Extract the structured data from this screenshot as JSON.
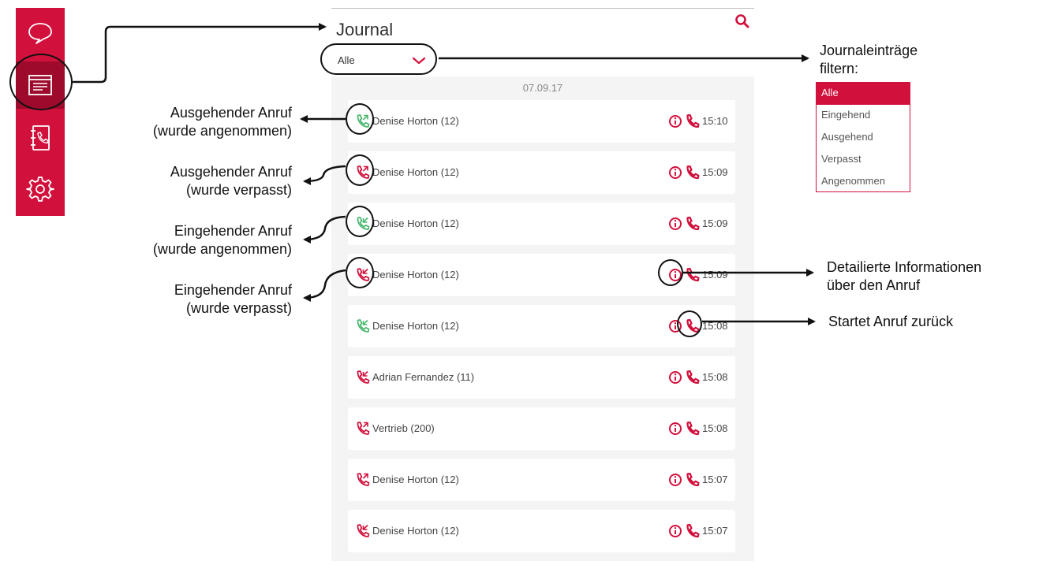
{
  "colors": {
    "accent": "#d2103c",
    "accent_dark": "#9e0a2c",
    "answered": "#49b86e",
    "missed": "#d2103c"
  },
  "sidebar": {
    "items": [
      {
        "name": "chat",
        "icon": "chat-bubble-icon",
        "active": false
      },
      {
        "name": "journal",
        "icon": "journal-icon",
        "active": true
      },
      {
        "name": "contacts",
        "icon": "phonebook-icon",
        "active": false
      },
      {
        "name": "settings",
        "icon": "gear-icon",
        "active": false
      }
    ]
  },
  "journal": {
    "title": "Journal",
    "search_icon": "search-icon",
    "filter": {
      "value": "Alle",
      "icon": "chevron-down-icon"
    },
    "date": "07.09.17",
    "entries": [
      {
        "direction": "outgoing",
        "status": "answered",
        "name": "Denise Horton (12)",
        "time": "15:10"
      },
      {
        "direction": "outgoing",
        "status": "missed",
        "name": "Denise Horton (12)",
        "time": "15:09"
      },
      {
        "direction": "incoming",
        "status": "answered",
        "name": "Denise Horton (12)",
        "time": "15:09"
      },
      {
        "direction": "incoming",
        "status": "missed",
        "name": "Denise Horton (12)",
        "time": "15:09"
      },
      {
        "direction": "incoming",
        "status": "answered",
        "name": "Denise Horton (12)",
        "time": "15:08"
      },
      {
        "direction": "incoming",
        "status": "missed",
        "name": "Adrian Fernandez (11)",
        "time": "15:08"
      },
      {
        "direction": "outgoing",
        "status": "missed",
        "name": "Vertrieb (200)",
        "time": "15:08"
      },
      {
        "direction": "outgoing",
        "status": "missed",
        "name": "Denise Horton (12)",
        "time": "15:07"
      },
      {
        "direction": "incoming",
        "status": "missed",
        "name": "Denise Horton (12)",
        "time": "15:07"
      }
    ]
  },
  "annotations": {
    "filter_heading": [
      "Journaleinträge",
      "filtern:"
    ],
    "filter_options": [
      "Alle",
      "Eingehend",
      "Ausgehend",
      "Verpasst",
      "Angenommen"
    ],
    "filter_selected": "Alle",
    "outgoing_answered": [
      "Ausgehender Anruf",
      "(wurde angenommen)"
    ],
    "outgoing_missed": [
      "Ausgehender Anruf",
      "(wurde verpasst)"
    ],
    "incoming_answered": [
      "Eingehender Anruf",
      "(wurde angenommen)"
    ],
    "incoming_missed": [
      "Eingehender Anruf",
      "(wurde verpasst)"
    ],
    "details": [
      "Detailierte Informationen",
      "über den Anruf"
    ],
    "callback": "Startet Anruf zurück"
  }
}
